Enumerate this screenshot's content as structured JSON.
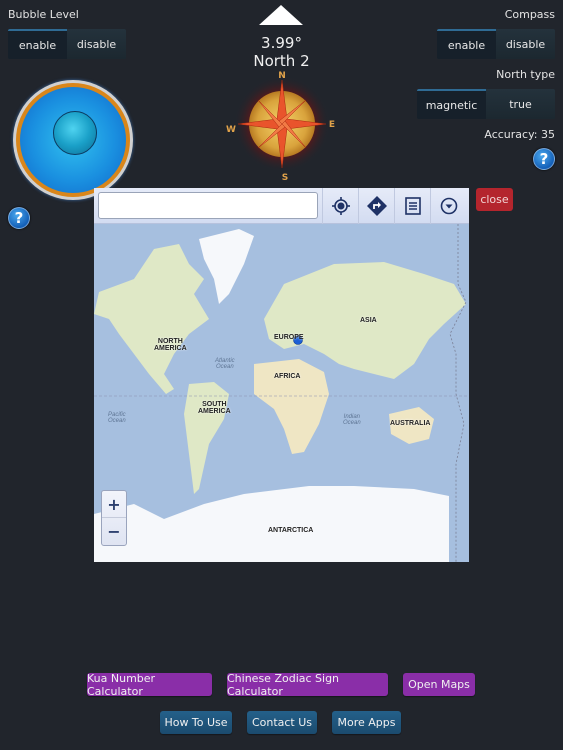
{
  "bubble_level": {
    "title": "Bubble Level",
    "toggle": {
      "options": [
        "enable",
        "disable"
      ],
      "selected": "enable"
    },
    "help_icon": "question-mark"
  },
  "heading": {
    "degrees": "3.99°",
    "direction": "North 2"
  },
  "compass_rose": {
    "labels": {
      "n": "N",
      "e": "E",
      "s": "S",
      "w": "W"
    }
  },
  "compass": {
    "title": "Compass",
    "toggle": {
      "options": [
        "enable",
        "disable"
      ],
      "selected": "enable"
    },
    "north_type_title": "North type",
    "north_type": {
      "options": [
        "magnetic",
        "true"
      ],
      "selected": "magnetic"
    },
    "accuracy": "Accuracy: 35",
    "help_icon": "question-mark"
  },
  "map": {
    "search": {
      "value": "",
      "placeholder": ""
    },
    "tools": [
      "locate-icon",
      "directions-icon",
      "list-icon",
      "dropdown-icon"
    ],
    "close_label": "close",
    "zoom_in": "+",
    "zoom_out": "−",
    "continent_labels": {
      "north_america": "NORTH\nAMERICA",
      "europe": "EUROPE",
      "asia": "ASIA",
      "africa": "AFRICA",
      "south_america": "SOUTH\nAMERICA",
      "australia": "AUSTRALIA",
      "antarctica": "ANTARCTICA"
    },
    "ocean_labels": {
      "atlantic": "Atlantic\nOcean",
      "pacific": "Pacific\nOcean",
      "indian": "Indian\nOcean"
    },
    "colors": {
      "water": "#a6bfdf",
      "land": "#dfe8c6",
      "ice": "#f6f8fb"
    }
  },
  "buttons": {
    "row1": [
      "Kua Number Calculator",
      "Chinese Zodiac Sign Calculator",
      "Open Maps"
    ],
    "row2": [
      "How To Use",
      "Contact Us",
      "More Apps"
    ]
  },
  "colors": {
    "background": "#21252c",
    "purple_button": "#8a2ea8",
    "blue_button": "#1f5880",
    "close_button": "#b4252d",
    "segment_active_line": "#2f6b94"
  }
}
